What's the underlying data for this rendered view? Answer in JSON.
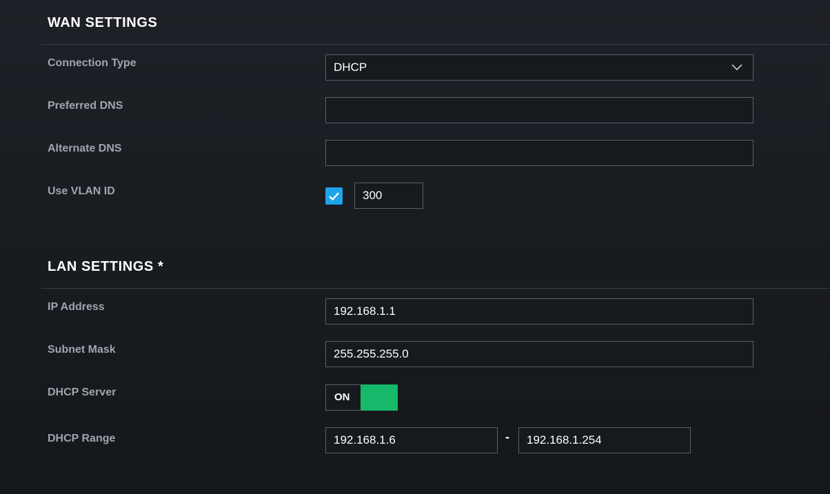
{
  "wan": {
    "title": "WAN SETTINGS",
    "connection_type_label": "Connection Type",
    "connection_type_value": "DHCP",
    "preferred_dns_label": "Preferred DNS",
    "preferred_dns_value": "",
    "alternate_dns_label": "Alternate DNS",
    "alternate_dns_value": "",
    "vlan_label": "Use VLAN ID",
    "vlan_enabled": true,
    "vlan_value": "300"
  },
  "lan": {
    "title": "LAN SETTINGS *",
    "ip_label": "IP Address",
    "ip_value": "192.168.1.1",
    "subnet_label": "Subnet Mask",
    "subnet_value": "255.255.255.0",
    "dhcp_server_label": "DHCP Server",
    "dhcp_server_state": "ON",
    "dhcp_range_label": "DHCP Range",
    "dhcp_range_start": "192.168.1.6",
    "dhcp_range_separator": "-",
    "dhcp_range_end": "192.168.1.254"
  },
  "icons": {
    "dropdown": "chevron-down-icon",
    "checkbox": "check-icon"
  },
  "colors": {
    "background": "#1b1e23",
    "label": "#a0a5ad",
    "input_border": "#5b6068",
    "checkbox": "#1fa3e8",
    "toggle_on": "#16b86a"
  }
}
